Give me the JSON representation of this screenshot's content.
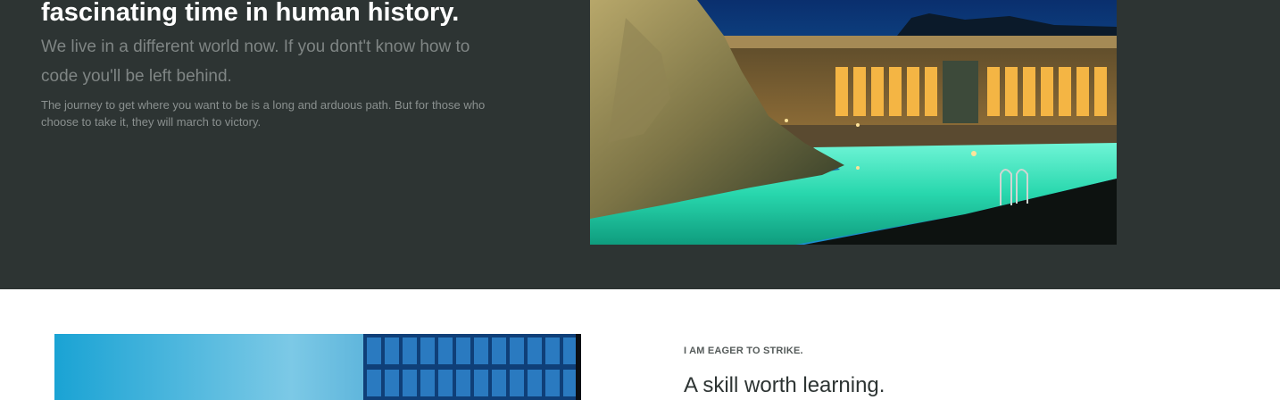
{
  "hero": {
    "heading": "fascinating time in human history.",
    "lead": "We live in a different world now. If you dont't know how to code you'll be left behind.",
    "body": "The journey to get where you want to be is a long and arduous path. But for those who choose to take it, they will march to victory."
  },
  "feature": {
    "eyebrow": "I AM EAGER TO STRIKE.",
    "heading": "A skill worth learning."
  },
  "colors": {
    "dark_bg": "#2d3433",
    "light_bg": "#ffffff",
    "pool": "#2fe0b4",
    "sky": "#1a8fc4"
  }
}
